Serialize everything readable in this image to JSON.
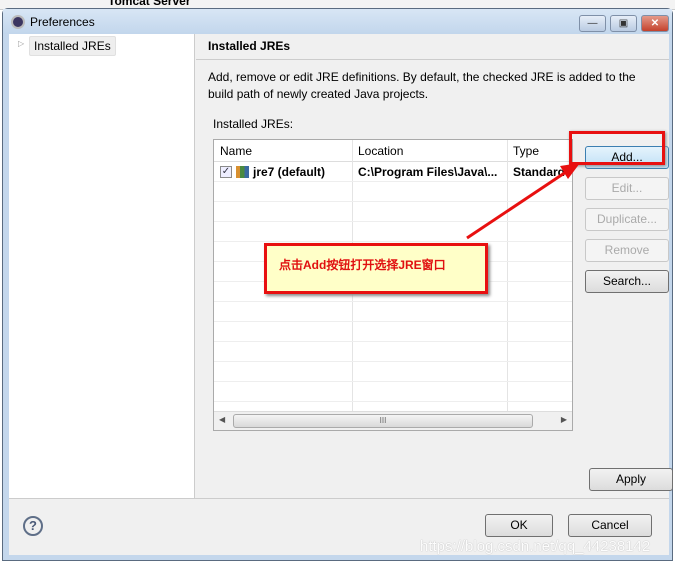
{
  "background": {
    "window_title": "Tomcat Server"
  },
  "window": {
    "title": "Preferences",
    "minimize": "—",
    "maximize": "▣",
    "close": "✕"
  },
  "tree": {
    "items": [
      {
        "label": "Installed JREs"
      }
    ]
  },
  "page": {
    "title": "Installed JREs",
    "description": "Add, remove or edit JRE definitions. By default, the checked JRE is added to the build path of newly created Java projects.",
    "table_label": "Installed JREs:"
  },
  "table": {
    "columns": [
      "Name",
      "Location",
      "Type"
    ],
    "rows": [
      {
        "checked": true,
        "name": "jre7 (default)",
        "location": "C:\\Program Files\\Java\\...",
        "type": "Standard"
      }
    ],
    "scroll_grip": "III"
  },
  "buttons": {
    "add": "Add...",
    "edit": "Edit...",
    "duplicate": "Duplicate...",
    "remove": "Remove",
    "search": "Search...",
    "apply": "Apply",
    "ok": "OK",
    "cancel": "Cancel",
    "help": "?"
  },
  "annotation": {
    "text": "点击Add按钮打开选择JRE窗口",
    "color": "#e81010"
  },
  "watermark": "https://blog.csdn.net/qq_44238142"
}
